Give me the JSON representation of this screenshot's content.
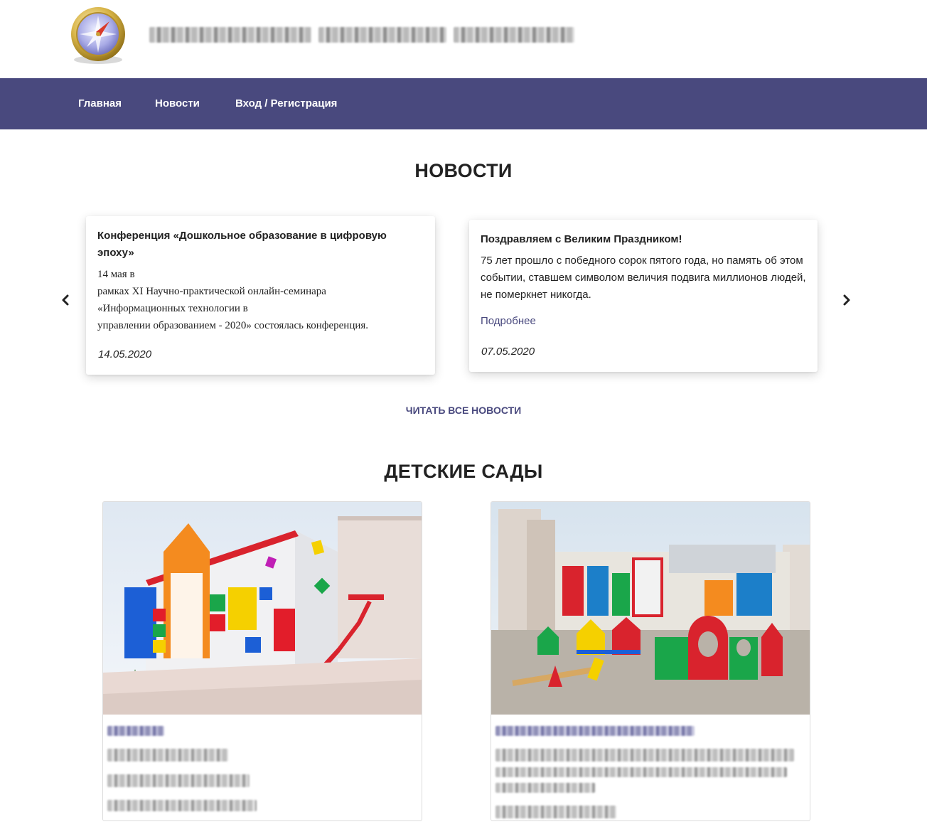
{
  "header": {
    "logo_icon": "compass-icon",
    "site_title_redacted": "site-title (pixelated, unreadable)"
  },
  "nav": {
    "items": [
      {
        "label": "Главная"
      },
      {
        "label": "Новости"
      },
      {
        "label": "Вход / Регистрация"
      }
    ],
    "background": "#49497e"
  },
  "news_section": {
    "title": "НОВОСТИ",
    "prev_icon": "chevron-left-icon",
    "next_icon": "chevron-right-icon",
    "cards": [
      {
        "title": "Конференция «Дошкольное образование в цифровую эпоху»",
        "body_lines": [
          "14 мая в",
          "рамках XI Научно-практической онлайн-семинара",
          "«Информационных технологии в",
          "управлении образованием - 2020» состоялась конференция."
        ],
        "date": "14.05.2020"
      },
      {
        "title": "Поздравляем с Великим Праздником!",
        "body": "75 лет прошло с победного сорок пятого года, но память об этом событии, ставшем символом величия подвига миллионов людей, не померкнет никогда.",
        "more_label": "Подробнее",
        "date": "07.05.2020"
      }
    ],
    "read_all_label": "ЧИТАТЬ ВСЕ НОВОСТИ"
  },
  "kindergartens_section": {
    "title": "ДЕТСКИЕ САДЫ",
    "cards": [
      {
        "image": "kindergarten-building-photo",
        "text_redacted": true
      },
      {
        "image": "kindergarten-playground-photo",
        "text_redacted": true
      }
    ]
  },
  "colors": {
    "accent": "#49497e",
    "text": "#222222"
  }
}
